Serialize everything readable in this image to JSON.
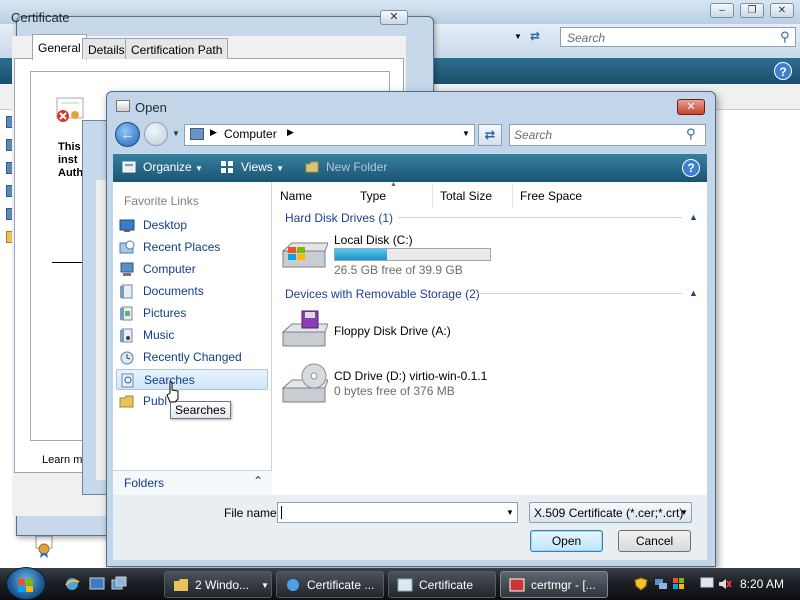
{
  "background_window": {
    "search_placeholder": "Search",
    "window_buttons": [
      "–",
      "❐",
      "✕"
    ],
    "help_label": "?"
  },
  "certificate_dialog": {
    "title": "Certificate",
    "close_label": "✕",
    "tabs": [
      "General",
      "Details",
      "Certification Path"
    ],
    "info_lines": [
      "This",
      "inst",
      "Auth"
    ],
    "learn_more": "Learn m"
  },
  "open_dialog": {
    "title": "Open",
    "close_label": "✕",
    "address": {
      "location": "Computer"
    },
    "search_placeholder": "Search",
    "toolbar": {
      "organize": "Organize",
      "views": "Views",
      "new_folder": "New Folder",
      "help": "?"
    },
    "favorite_links": {
      "header": "Favorite Links",
      "items": [
        {
          "label": "Desktop"
        },
        {
          "label": "Recent Places"
        },
        {
          "label": "Computer"
        },
        {
          "label": "Documents"
        },
        {
          "label": "Pictures"
        },
        {
          "label": "Music"
        },
        {
          "label": "Recently Changed"
        },
        {
          "label": "Searches"
        },
        {
          "label": "Publ"
        }
      ],
      "selected": "Searches",
      "tooltip": "Searches"
    },
    "folders_label": "Folders",
    "columns": [
      "Name",
      "Type",
      "Total Size",
      "Free Space"
    ],
    "groups": [
      {
        "title": "Hard Disk Drives (1)",
        "items": [
          {
            "name": "Local Disk (C:)",
            "detail": "26.5 GB free of 39.9 GB",
            "used_fraction": 0.336
          }
        ]
      },
      {
        "title": "Devices with Removable Storage (2)",
        "items": [
          {
            "name": "Floppy Disk Drive (A:)"
          },
          {
            "name": "CD Drive (D:) virtio-win-0.1.1",
            "detail": "0 bytes free of 376 MB"
          }
        ]
      }
    ],
    "file_name_label": "File name:",
    "file_name_value": "",
    "file_type": "X.509 Certificate (*.cer;*.crt)",
    "open_button": "Open",
    "cancel_button": "Cancel"
  },
  "taskbar": {
    "buttons": [
      {
        "label": "2 Windo..."
      },
      {
        "label": "Certificate ..."
      },
      {
        "label": "Certificate"
      },
      {
        "label": "certmgr - [..."
      }
    ],
    "clock": "8:20 AM"
  },
  "colors": {
    "accent_toolbar": "#1b5473",
    "link_blue": "#0f3f87",
    "group_blue": "#1e3f8f",
    "close_red": "#c5432e",
    "progress_blue": "#1f90c5"
  }
}
